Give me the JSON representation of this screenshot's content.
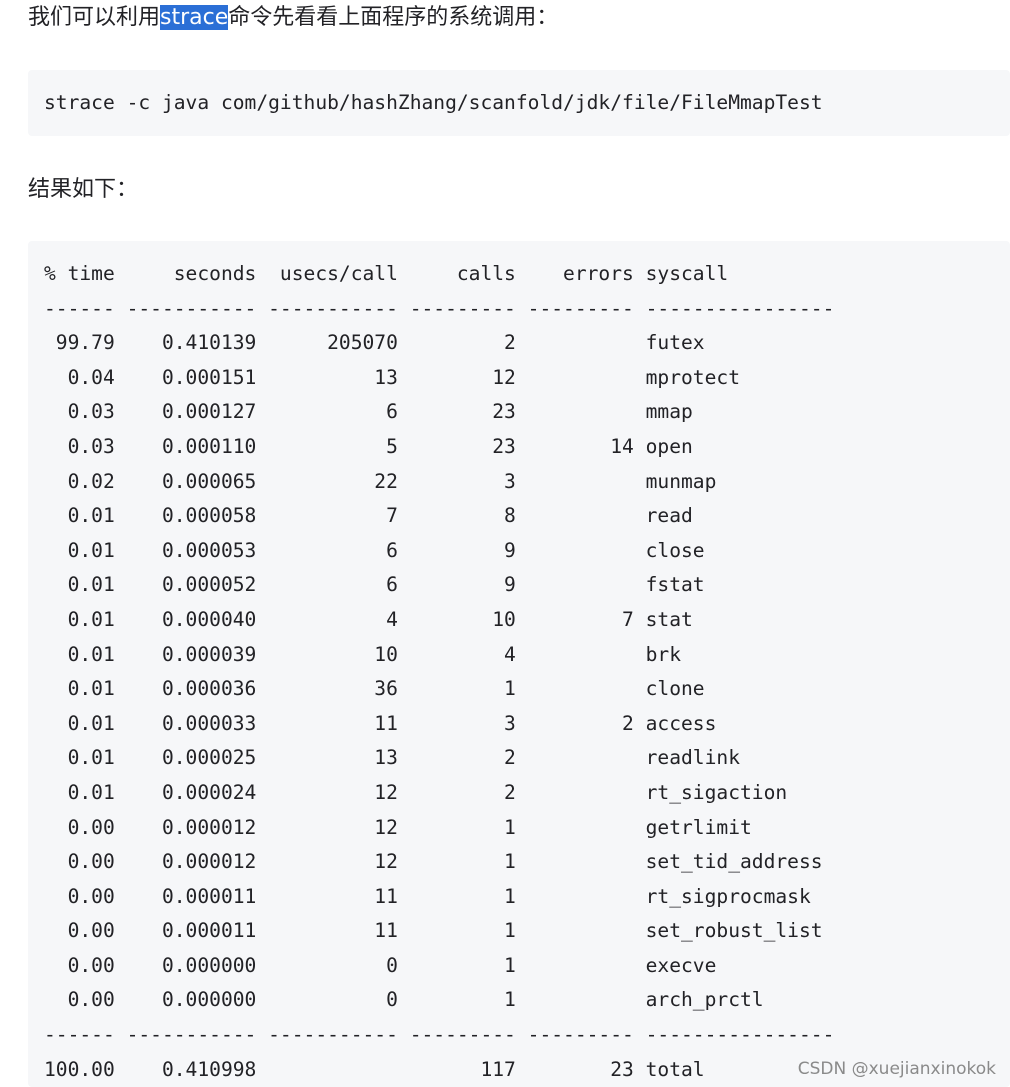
{
  "intro": {
    "before": "我们可以利用",
    "highlight": "strace",
    "after": "命令先看看上面程序的系统调用："
  },
  "command": "strace -c java com/github/hashZhang/scanfold/jdk/file/FileMmapTest",
  "result_label": "结果如下：",
  "strace_table": {
    "columns": [
      "% time",
      "seconds",
      "usecs/call",
      "calls",
      "errors",
      "syscall"
    ],
    "separator": "------ ----------- ----------- --------- --------- ----------------",
    "rows": [
      [
        "99.79",
        "0.410139",
        "205070",
        "2",
        "",
        "futex"
      ],
      [
        "0.04",
        "0.000151",
        "13",
        "12",
        "",
        "mprotect"
      ],
      [
        "0.03",
        "0.000127",
        "6",
        "23",
        "",
        "mmap"
      ],
      [
        "0.03",
        "0.000110",
        "5",
        "23",
        "14",
        "open"
      ],
      [
        "0.02",
        "0.000065",
        "22",
        "3",
        "",
        "munmap"
      ],
      [
        "0.01",
        "0.000058",
        "7",
        "8",
        "",
        "read"
      ],
      [
        "0.01",
        "0.000053",
        "6",
        "9",
        "",
        "close"
      ],
      [
        "0.01",
        "0.000052",
        "6",
        "9",
        "",
        "fstat"
      ],
      [
        "0.01",
        "0.000040",
        "4",
        "10",
        "7",
        "stat"
      ],
      [
        "0.01",
        "0.000039",
        "10",
        "4",
        "",
        "brk"
      ],
      [
        "0.01",
        "0.000036",
        "36",
        "1",
        "",
        "clone"
      ],
      [
        "0.01",
        "0.000033",
        "11",
        "3",
        "2",
        "access"
      ],
      [
        "0.01",
        "0.000025",
        "13",
        "2",
        "",
        "readlink"
      ],
      [
        "0.01",
        "0.000024",
        "12",
        "2",
        "",
        "rt_sigaction"
      ],
      [
        "0.00",
        "0.000012",
        "12",
        "1",
        "",
        "getrlimit"
      ],
      [
        "0.00",
        "0.000012",
        "12",
        "1",
        "",
        "set_tid_address"
      ],
      [
        "0.00",
        "0.000011",
        "11",
        "1",
        "",
        "rt_sigprocmask"
      ],
      [
        "0.00",
        "0.000011",
        "11",
        "1",
        "",
        "set_robust_list"
      ],
      [
        "0.00",
        "0.000000",
        "0",
        "1",
        "",
        "execve"
      ],
      [
        "0.00",
        "0.000000",
        "0",
        "1",
        "",
        "arch_prctl"
      ]
    ],
    "total": [
      "100.00",
      "0.410998",
      "",
      "117",
      "23",
      "total"
    ]
  },
  "watermark": "CSDN @xuejianxinokok"
}
